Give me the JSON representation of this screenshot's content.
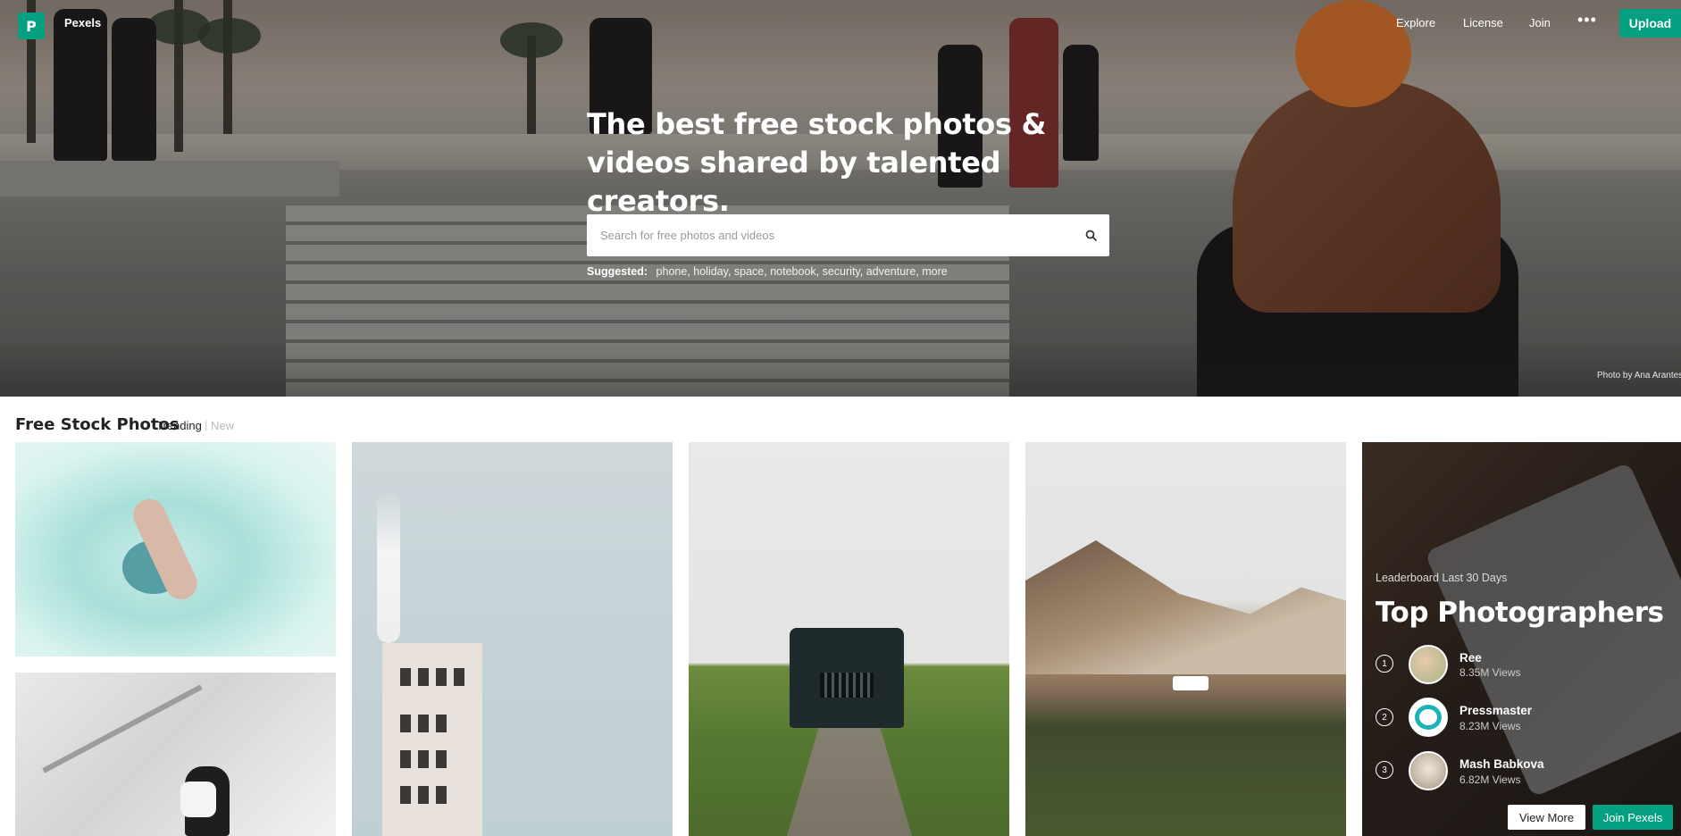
{
  "brand": {
    "name": "Pexels",
    "accent_color": "#05a081"
  },
  "nav": {
    "explore": "Explore",
    "license": "License",
    "join": "Join",
    "more": "•••",
    "upload": "Upload"
  },
  "hero": {
    "headline": "The best free stock photos & videos shared by talented creators.",
    "search_placeholder": "Search for free photos and videos",
    "suggested_label": "Suggested:",
    "suggestions": [
      "phone",
      "holiday",
      "space",
      "notebook",
      "security",
      "adventure",
      "more"
    ],
    "photo_credit": "Photo by Ana Arantes"
  },
  "section": {
    "title": "Free Stock Photos",
    "tabs": [
      "Trending",
      "New"
    ],
    "separator": "|"
  },
  "leaderboard": {
    "subtitle": "Leaderboard Last 30 Days",
    "title": "Top Photographers",
    "photographers": [
      {
        "rank": "1",
        "name": "Ree",
        "views": "8.35M Views"
      },
      {
        "rank": "2",
        "name": "Pressmaster",
        "views": "8.23M Views"
      },
      {
        "rank": "3",
        "name": "Mash Babkova",
        "views": "6.82M Views"
      }
    ],
    "view_more": "View More",
    "join_pexels": "Join Pexels"
  },
  "icons": {
    "logo": "pexels-logo-icon",
    "search": "search-icon",
    "more": "more-dots-icon"
  }
}
